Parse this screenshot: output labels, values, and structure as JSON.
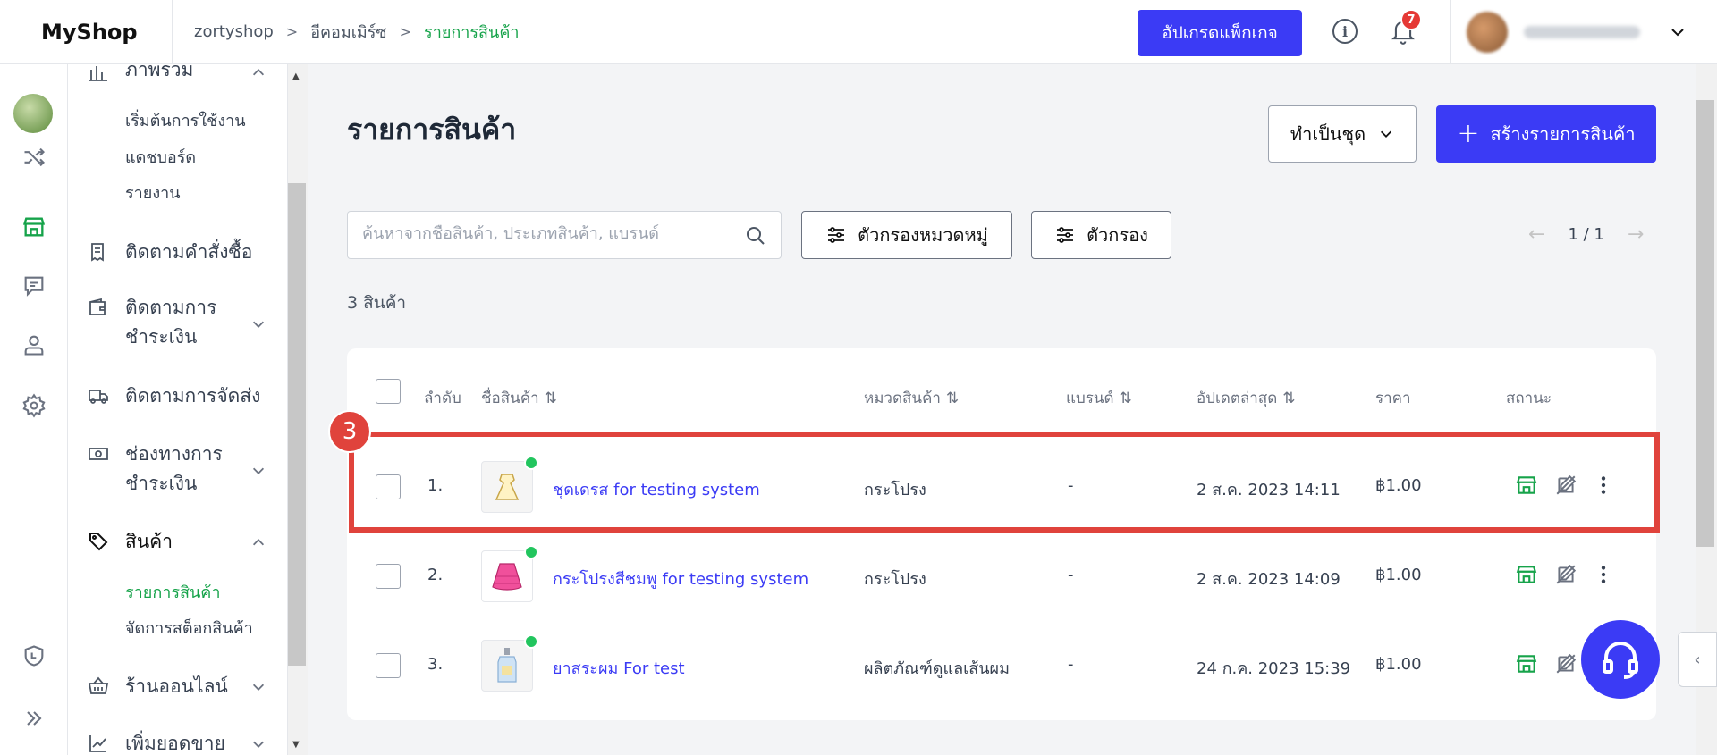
{
  "app": {
    "logo": "MyShop"
  },
  "breadcrumb": {
    "items": [
      "zortyshop",
      "อีคอมเมิร์ซ",
      "รายการสินค้า"
    ]
  },
  "topbar": {
    "upgrade_label": "อัปเกรดแพ็กเกจ",
    "info_glyph": "i",
    "notification_count": "7"
  },
  "sidebar": {
    "overview_label": "ภาพรวม",
    "overview_sub": [
      "เริ่มต้นการใช้งาน",
      "แดชบอร์ด",
      "รายงาน"
    ],
    "track_orders": "ติดตามคำสั่งซื้อ",
    "track_payment": [
      "ติดตามการ",
      "ชำระเงิน"
    ],
    "track_shipping": "ติดตามการจัดส่ง",
    "payment_channels": [
      "ช่องทางการ",
      "ชำระเงิน"
    ],
    "products_label": "สินค้า",
    "products_sub": [
      "รายการสินค้า",
      "จัดการสต็อกสินค้า"
    ],
    "online_store": "ร้านออนไลน์",
    "boost_sales": "เพิ่มยอดขาย"
  },
  "page": {
    "title": "รายการสินค้า",
    "batch_label": "ทำเป็นชุด",
    "create_label": "สร้างรายการสินค้า",
    "create_plus": "+",
    "search_placeholder": "ค้นหาจากชื่อสินค้า, ประเภทสินค้า, แบรนด์",
    "category_filter_label": "ตัวกรองหมวดหมู่",
    "filter_label": "ตัวกรอง",
    "pager": {
      "prev": "←",
      "text": "1 / 1",
      "next": "→"
    },
    "count_label": "3 สินค้า",
    "step_number": "3"
  },
  "table": {
    "headers": {
      "index": "ลำดับ",
      "name": "ชื่อสินค้า",
      "category": "หมวดสินค้า",
      "brand": "แบรนด์",
      "updated": "อัปเดตล่าสุด",
      "price": "ราคา",
      "status": "สถานะ"
    },
    "sort_glyph": "⇅",
    "rows": [
      {
        "index": "1.",
        "name": "ชุดเดรส for testing system",
        "category": "กระโปรง",
        "brand": "-",
        "updated": "2 ส.ค. 2023 14:11",
        "price": "฿1.00",
        "thumb": "dress-icon"
      },
      {
        "index": "2.",
        "name": "กระโปรงสีชมพู for testing system",
        "category": "กระโปรง",
        "brand": "-",
        "updated": "2 ส.ค. 2023 14:09",
        "price": "฿1.00",
        "thumb": "skirt-icon"
      },
      {
        "index": "3.",
        "name": "ยาสระผม For test",
        "category": "ผลิตภัณฑ์ดูแลเส้นผม",
        "brand": "-",
        "updated": "24 ก.ค. 2023 15:39",
        "price": "฿1.00",
        "thumb": "shampoo-icon"
      }
    ]
  },
  "colors": {
    "primary": "#3b3bf5",
    "active_green": "#16a34a",
    "status_dot": "#22c55e",
    "highlight": "#e0433c"
  }
}
